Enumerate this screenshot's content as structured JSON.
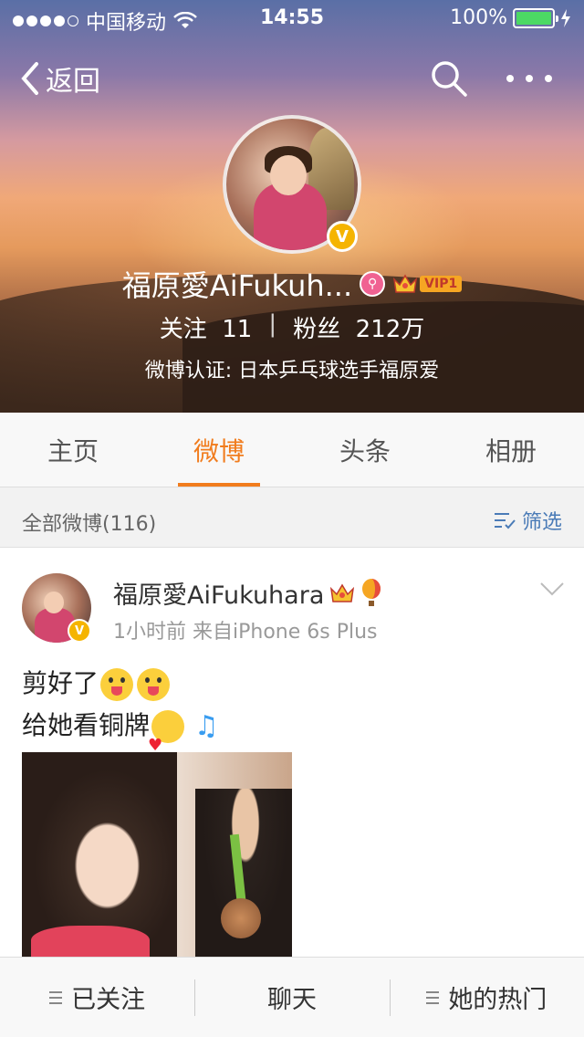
{
  "status_bar": {
    "carrier": "中国移动",
    "time": "14:55",
    "battery": "100%"
  },
  "nav": {
    "back_label": "返回"
  },
  "profile": {
    "name": "福原愛AiFukuh...",
    "vip_label": "VIP1",
    "following_label": "关注",
    "following_count": "11",
    "separator": "|",
    "followers_label": "粉丝",
    "followers_count": "212万",
    "verification": "微博认证: 日本乒乓球选手福原爱"
  },
  "tabs": [
    {
      "label": "主页"
    },
    {
      "label": "微博"
    },
    {
      "label": "头条"
    },
    {
      "label": "相册"
    }
  ],
  "active_tab": "微博",
  "filter_bar": {
    "count_label": "全部微博(116)",
    "filter_label": "筛选"
  },
  "post": {
    "author": "福原愛AiFukuhara",
    "meta": "1小时前  来自iPhone 6s Plus",
    "line1": "剪好了",
    "line2": "给她看铜牌"
  },
  "bottom_bar": {
    "followed_label": "已关注",
    "chat_label": "聊天",
    "hot_label": "她的热门"
  },
  "colors": {
    "accent": "#f17c1d",
    "link": "#4a7bb7",
    "verified_badge": "#f5b400",
    "battery": "#4cd964"
  }
}
